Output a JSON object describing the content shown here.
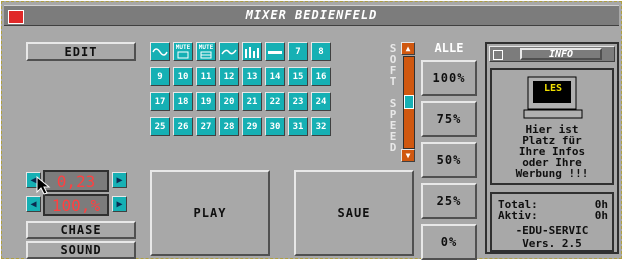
{
  "window": {
    "title": "MIXER BEDIENFELD"
  },
  "edit_label": "EDIT",
  "alle_label": "ALLE",
  "grid": {
    "icons": [
      "sine-wave-icon",
      "mute-icon",
      "mute-icon",
      "wave-icon",
      "bars-icon",
      "line-icon"
    ],
    "mute_text": "MUTE",
    "cells": [
      "7",
      "8",
      "9",
      "10",
      "11",
      "12",
      "13",
      "14",
      "15",
      "16",
      "17",
      "18",
      "19",
      "20",
      "21",
      "22",
      "23",
      "24",
      "25",
      "26",
      "27",
      "28",
      "29",
      "30",
      "31",
      "32"
    ]
  },
  "speed_letters": [
    "S",
    "O",
    "F",
    "T",
    "",
    "S",
    "P",
    "E",
    "E",
    "D"
  ],
  "values": {
    "time": "0,23",
    "percent": "100,%"
  },
  "buttons": {
    "chase": "CHASE",
    "sound": "SOUND",
    "play": "PLAY",
    "save": "SAUE"
  },
  "levels": [
    "100%",
    "75%",
    "50%",
    "25%",
    "0%"
  ],
  "info": {
    "header": "INFO",
    "monitor_text": "LES",
    "message": [
      "Hier ist",
      "Platz für",
      "Ihre Infos",
      "oder Ihre",
      "Werbung !!!"
    ],
    "total_label": "Total:",
    "total_value": "0h",
    "aktiv_label": "Aktiv:",
    "aktiv_value": "0h",
    "company": "-EDU-SERVIC",
    "version": "Vers. 2.5"
  },
  "colors": {
    "window": "#a8a8a8",
    "titlebar": "#7c7c7c",
    "cell": "#16b0b4",
    "slider": "#d05810",
    "lcd_text": "#ff4040"
  }
}
